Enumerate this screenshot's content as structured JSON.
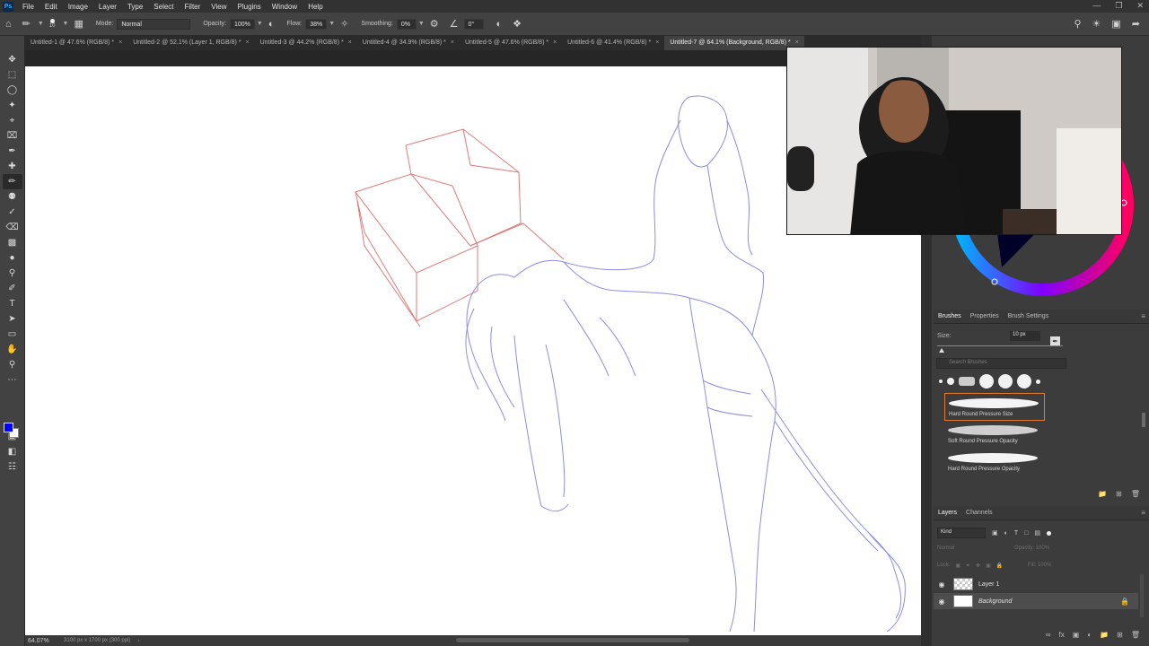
{
  "app": {
    "logo": "Ps"
  },
  "menu": [
    "File",
    "Edit",
    "Image",
    "Layer",
    "Type",
    "Select",
    "Filter",
    "View",
    "Plugins",
    "Window",
    "Help"
  ],
  "options": {
    "brush_size_small": "10",
    "mode_label": "Mode:",
    "mode_value": "Normal",
    "opacity_label": "Opacity:",
    "opacity_value": "100%",
    "flow_label": "Flow:",
    "flow_value": "38%",
    "smoothing_label": "Smoothing:",
    "smoothing_value": "0%",
    "angle_value": "0°"
  },
  "tabs": [
    {
      "label": "Untitled-1 @ 47.6% (RGB/8) *",
      "active": false
    },
    {
      "label": "Untitled-2 @ 52.1% (Layer 1, RGB/8) *",
      "active": false
    },
    {
      "label": "Untitled-3 @ 44.2% (RGB/8) *",
      "active": false
    },
    {
      "label": "Untitled-4 @ 34.9% (RGB/8) *",
      "active": false
    },
    {
      "label": "Untitled-5 @ 47.6% (RGB/8) *",
      "active": false
    },
    {
      "label": "Untitled-6 @ 41.4% (RGB/8) *",
      "active": false
    },
    {
      "label": "Untitled-7 @ 64.1% (Background, RGB/8) *",
      "active": true
    }
  ],
  "colors": {
    "foreground": "#0000ff",
    "background": "#ffffff",
    "sketch_blue": "#8c8ce6",
    "sketch_red": "#e07a7a",
    "accent_orange": "#e0782e"
  },
  "status": {
    "zoom": "64.07%",
    "dimensions": "3100 px x 1700 px (300 ppi)"
  },
  "brushes_panel": {
    "tabs": [
      "Brushes",
      "Properties",
      "Brush Settings"
    ],
    "size_label": "Size:",
    "size_value": "10 px",
    "search_placeholder": "Search Brushes",
    "items": [
      {
        "name": "Hard Round Pressure Size",
        "selected": true
      },
      {
        "name": "Soft Round Pressure Opacity",
        "selected": false
      },
      {
        "name": "Hard Round Pressure Opacity",
        "selected": false
      }
    ]
  },
  "layers_panel": {
    "tabs": [
      "Layers",
      "Channels"
    ],
    "kind_label": "Kind",
    "blend_mode": "Normal",
    "opacity_label": "Opacity:",
    "opacity_value": "100%",
    "lock_label": "Lock:",
    "fill_label": "Fill:",
    "fill_value": "100%",
    "layers": [
      {
        "name": "Layer 1",
        "selected": false
      },
      {
        "name": "Background",
        "selected": true
      }
    ]
  }
}
